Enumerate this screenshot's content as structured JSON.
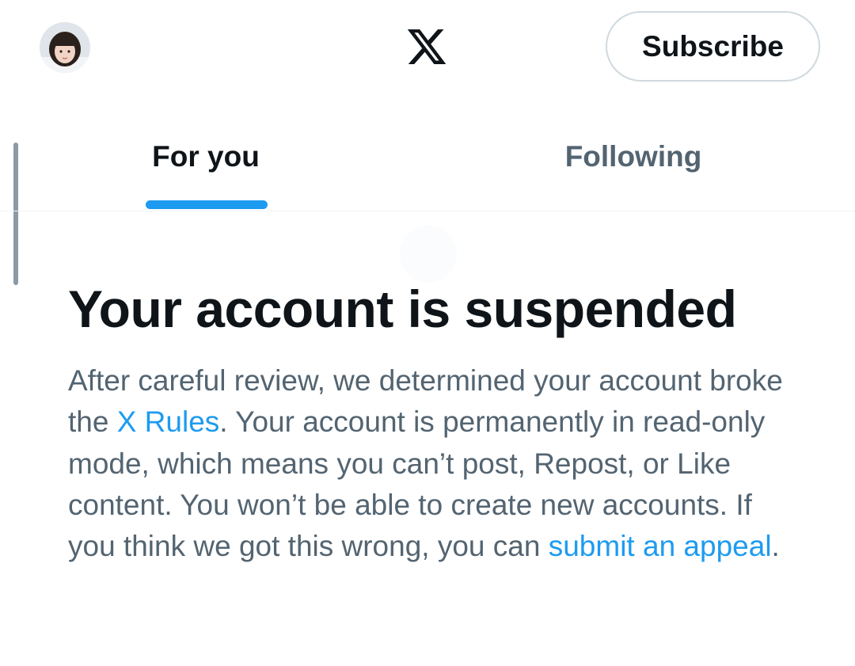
{
  "header": {
    "subscribe_label": "Subscribe"
  },
  "tabs": [
    {
      "label": "For you",
      "active": true
    },
    {
      "label": "Following",
      "active": false
    }
  ],
  "notice": {
    "title": "Your account is suspended",
    "body_part1": "After careful review, we determined your account broke the ",
    "rules_link": "X Rules",
    "body_part2": ". Your account is permanently in read-only mode, which means you can’t post, Repost, or Like content. You won’t be able to create new accounts. If you think we got this wrong, you can ",
    "appeal_link": "submit an appeal",
    "body_end": "."
  },
  "colors": {
    "accent": "#1d9bf0",
    "text_primary": "#0f1419",
    "text_secondary": "#536471",
    "border": "#cfd9de"
  },
  "icons": {
    "logo": "x-logo-icon",
    "avatar": "profile-avatar"
  }
}
